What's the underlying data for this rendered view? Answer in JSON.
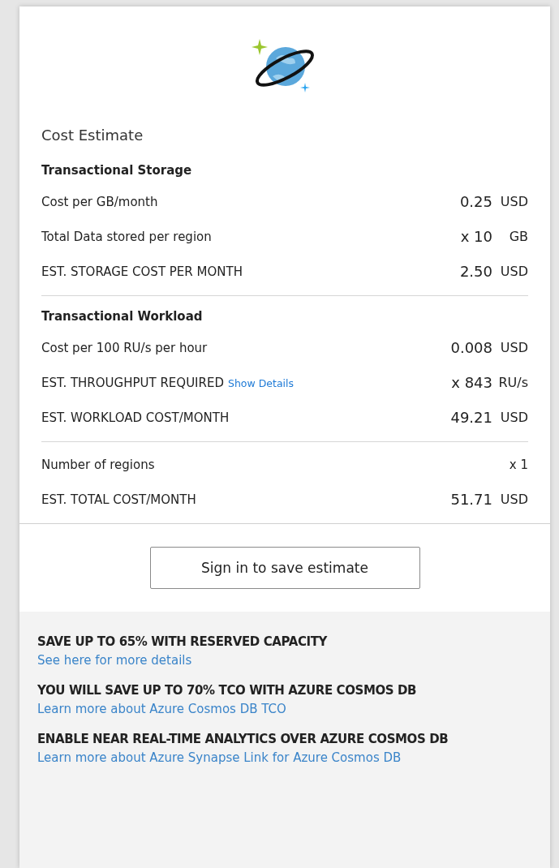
{
  "title": "Cost Estimate",
  "sections": [
    {
      "title": "Transactional Storage",
      "rows": [
        {
          "label": "Cost per GB/month",
          "value": "0.25",
          "unit": "USD",
          "kind": "plain"
        },
        {
          "label": "Total Data stored per region",
          "value": "x 10",
          "unit": "GB",
          "kind": "plain"
        },
        {
          "label": "EST. STORAGE COST PER MONTH",
          "value": "2.50",
          "unit": "USD",
          "kind": "total"
        }
      ]
    },
    {
      "title": "Transactional Workload",
      "rows": [
        {
          "label": "Cost per 100 RU/s per hour",
          "value": "0.008",
          "unit": "USD",
          "kind": "plain"
        },
        {
          "label": "EST. THROUGHPUT REQUIRED",
          "link": "Show Details",
          "value": "x 843",
          "unit": "RU/s",
          "kind": "total"
        },
        {
          "label": "EST. WORKLOAD COST/MONTH",
          "value": "49.21",
          "unit": "USD",
          "kind": "total"
        }
      ]
    },
    {
      "rows": [
        {
          "label": "Number of regions",
          "value": "x 1",
          "kind": "small"
        },
        {
          "label": "EST. TOTAL COST/MONTH",
          "value": "51.71",
          "unit": "USD",
          "kind": "total"
        }
      ]
    }
  ],
  "button": "Sign in to save estimate",
  "promos": [
    {
      "heading": "SAVE UP TO 65% WITH RESERVED CAPACITY",
      "link": "See here for more details"
    },
    {
      "heading": "YOU WILL SAVE UP TO 70% TCO WITH AZURE COSMOS DB",
      "link": "Learn more about Azure Cosmos DB TCO"
    },
    {
      "heading": "ENABLE NEAR REAL-TIME ANALYTICS OVER AZURE COSMOS DB",
      "link": "Learn more about Azure Synapse Link for Azure Cosmos DB"
    }
  ]
}
